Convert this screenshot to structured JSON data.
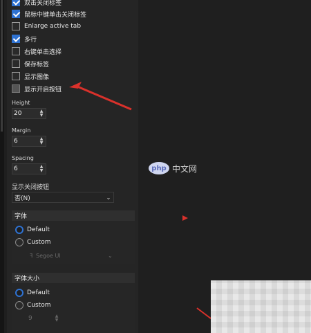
{
  "checkboxes": [
    {
      "label": "双击关闭标签",
      "checked": true
    },
    {
      "label": "鼠标中键单击关闭标签",
      "checked": true
    },
    {
      "label": "Enlarge active tab",
      "checked": false
    },
    {
      "label": "多行",
      "checked": true
    },
    {
      "label": "右键单击选择",
      "checked": false
    },
    {
      "label": "保存标签",
      "checked": false
    },
    {
      "label": "显示图像",
      "checked": false
    },
    {
      "label": "显示开启按钮",
      "checked": false
    }
  ],
  "height": {
    "label": "Height",
    "value": "20"
  },
  "margin": {
    "label": "Margin",
    "value": "6"
  },
  "spacing": {
    "label": "Spacing",
    "value": "6"
  },
  "close_button": {
    "label": "显示关闭按钮",
    "value": "否(N)"
  },
  "font_group": {
    "title": "字体",
    "default_label": "Default",
    "custom_label": "Custom",
    "font_name": "Segoe UI"
  },
  "size_group": {
    "title": "字体大小",
    "default_label": "Default",
    "custom_label": "Custom",
    "size_value": "9"
  },
  "watermark": {
    "logo": "php",
    "text": "中文网"
  },
  "colors": {
    "accent": "#2e72d2",
    "arrow": "#d9312b"
  }
}
